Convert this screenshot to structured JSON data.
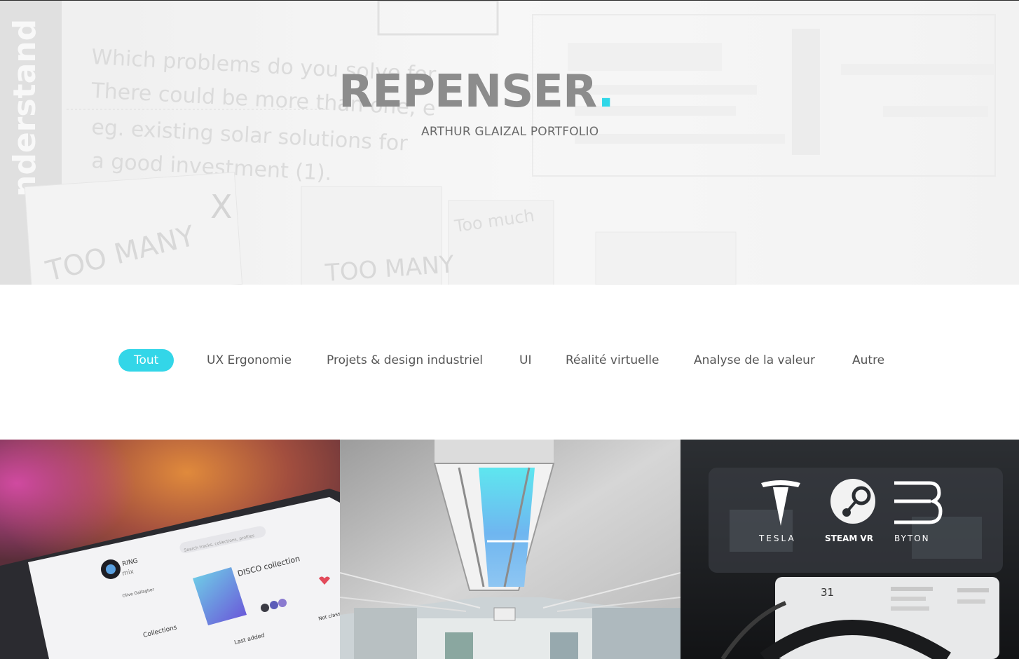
{
  "hero": {
    "title": "REPENSER",
    "title_dot": ".",
    "subtitle": "ARTHUR GLAIZAL PORTFOLIO",
    "photo_text": {
      "side_word": "nderstand",
      "line1": "Which problems do you solve for",
      "line2": "There could be more than one, e",
      "line3": "eg. existing solar solutions for",
      "line4": "a good investment (1).",
      "note_left": "TOO MANY",
      "note_left_x": "X",
      "note_right": "TOO MANY",
      "note_right_2": "Too much"
    }
  },
  "filters": {
    "items": [
      {
        "label": "Tout",
        "active": true
      },
      {
        "label": "UX Ergonomie"
      },
      {
        "label": "Projets & design industriel"
      },
      {
        "label": "UI"
      },
      {
        "label": "Réalité virtuelle"
      },
      {
        "label": "Analyse de la valeur"
      },
      {
        "label": "Autre"
      }
    ]
  },
  "gallery": {
    "tile1": {
      "app_name_1": "RING",
      "app_name_2": "mix",
      "search_placeholder": "Search tracks, collections, profiles",
      "collection_title": "DISCO collection",
      "user": "Olive Gallagher",
      "collections_label": "Collections",
      "last_added": "Last added",
      "not_classified": "Not classified"
    },
    "tile3": {
      "logo1": "TESLA",
      "logo2": "STEAM VR",
      "logo3": "BYTON",
      "dash_number": "31"
    }
  },
  "colors": {
    "accent": "#33d6e8",
    "title_gray": "#8c8c8c"
  }
}
